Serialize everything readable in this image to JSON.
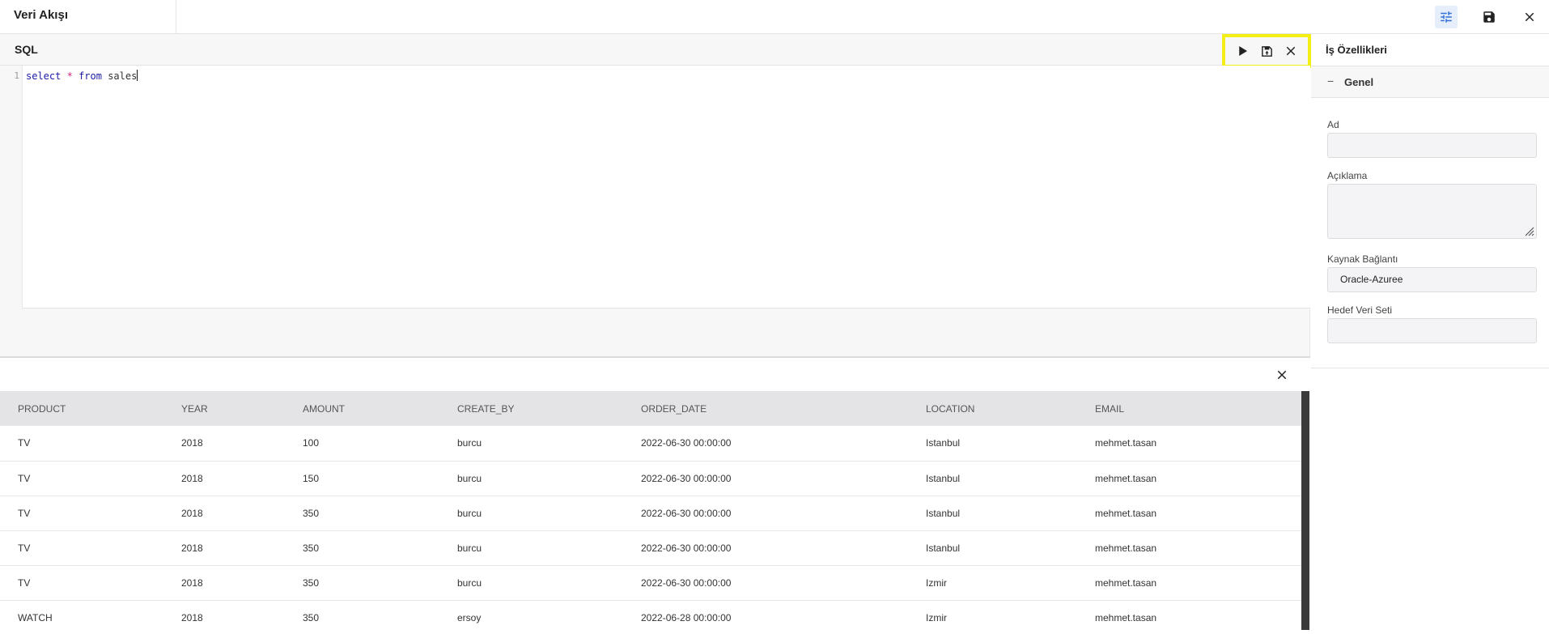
{
  "header": {
    "title": "Veri Akışı",
    "icons": [
      "tune-icon",
      "save-icon",
      "close-icon"
    ],
    "accent": "#2f6fd6"
  },
  "sql": {
    "title": "SQL",
    "line_number": "1",
    "code": {
      "kw1": "select",
      "op": "*",
      "kw2": "from",
      "table": "sales"
    },
    "actions": [
      "play-icon",
      "save-icon",
      "close-icon"
    ],
    "highlight_color": "#f2ee16"
  },
  "results": {
    "columns": [
      "PRODUCT",
      "YEAR",
      "AMOUNT",
      "CREATE_BY",
      "ORDER_DATE",
      "LOCATION",
      "EMAIL"
    ],
    "rows": [
      [
        "TV",
        "2018",
        "100",
        "burcu",
        "2022-06-30 00:00:00",
        "Istanbul",
        "mehmet.tasan"
      ],
      [
        "TV",
        "2018",
        "150",
        "burcu",
        "2022-06-30 00:00:00",
        "Istanbul",
        "mehmet.tasan"
      ],
      [
        "TV",
        "2018",
        "350",
        "burcu",
        "2022-06-30 00:00:00",
        "Istanbul",
        "mehmet.tasan"
      ],
      [
        "TV",
        "2018",
        "350",
        "burcu",
        "2022-06-30 00:00:00",
        "Istanbul",
        "mehmet.tasan"
      ],
      [
        "TV",
        "2018",
        "350",
        "burcu",
        "2022-06-30 00:00:00",
        "Izmir",
        "mehmet.tasan"
      ],
      [
        "WATCH",
        "2018",
        "350",
        "ersoy",
        "2022-06-28 00:00:00",
        "Izmir",
        "mehmet.tasan"
      ]
    ]
  },
  "properties": {
    "title": "İş Özellikleri",
    "section": {
      "label": "Genel",
      "collapse_symbol": "−"
    },
    "fields": {
      "name_label": "Ad",
      "name_value": "",
      "description_label": "Açıklama",
      "description_value": "",
      "source_label": "Kaynak Bağlantı",
      "source_value": "Oracle-Azuree",
      "target_label": "Hedef Veri Seti",
      "target_value": ""
    }
  }
}
